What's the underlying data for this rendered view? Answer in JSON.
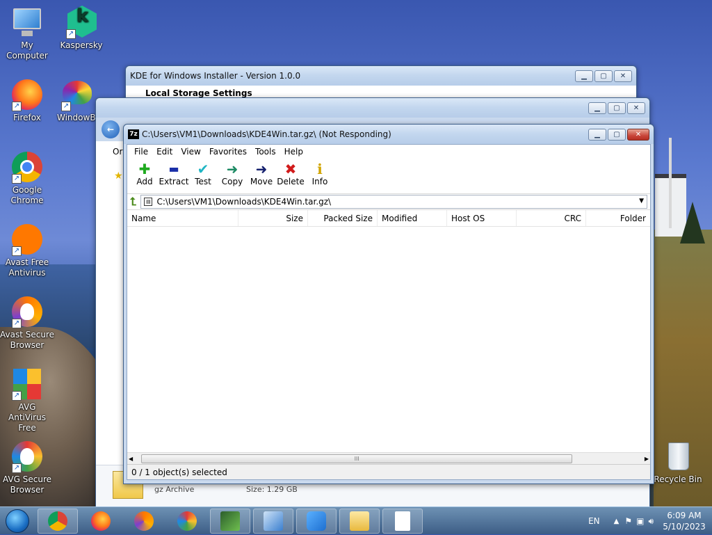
{
  "desktop": {
    "icons": [
      {
        "label": "My Computer"
      },
      {
        "label": "Kaspersky"
      },
      {
        "label": "Firefox"
      },
      {
        "label": "WindowBl"
      },
      {
        "label": "Google Chrome"
      },
      {
        "label": "Avast Free Antivirus"
      },
      {
        "label": "Avast Secure Browser"
      },
      {
        "label": "AVG AntiVirus Free"
      },
      {
        "label": "AVG Secure Browser"
      },
      {
        "label": "Recycle Bin"
      }
    ]
  },
  "kde_window": {
    "title": "KDE for Windows Installer - Version 1.0.0",
    "heading": "Local Storage Settings"
  },
  "explorer_window": {
    "left_label": "Or",
    "file_type": "gz Archive",
    "file_size": "Size: 1.29 GB"
  },
  "sevenzip": {
    "title": "C:\\Users\\VM1\\Downloads\\KDE4Win.tar.gz\\ (Not Responding)",
    "app_glyph": "7z",
    "menu": [
      "File",
      "Edit",
      "View",
      "Favorites",
      "Tools",
      "Help"
    ],
    "toolbar": [
      {
        "label": "Add",
        "icon": "plus-icon",
        "glyph": "✚",
        "color": "#1faa1f"
      },
      {
        "label": "Extract",
        "icon": "minus-icon",
        "glyph": "▬",
        "color": "#1a2fa8"
      },
      {
        "label": "Test",
        "icon": "check-icon",
        "glyph": "✔",
        "color": "#20b6c4"
      },
      {
        "label": "Copy",
        "icon": "arrow-right-copy-icon",
        "glyph": "➜",
        "color": "#1c8a63"
      },
      {
        "label": "Move",
        "icon": "arrow-right-move-icon",
        "glyph": "➜",
        "color": "#15206e"
      },
      {
        "label": "Delete",
        "icon": "x-icon",
        "glyph": "✖",
        "color": "#d11b1b"
      },
      {
        "label": "Info",
        "icon": "info-icon",
        "glyph": "ℹ",
        "color": "#d1a400"
      }
    ],
    "address": "C:\\Users\\VM1\\Downloads\\KDE4Win.tar.gz\\",
    "columns": [
      "Name",
      "Size",
      "Packed Size",
      "Modified",
      "Host OS",
      "CRC",
      "Folder"
    ],
    "status": "0 / 1 object(s) selected",
    "scroll_grip": "III"
  },
  "taskbar": {
    "language": "EN",
    "time": "6:09 AM",
    "date": "5/10/2023"
  }
}
